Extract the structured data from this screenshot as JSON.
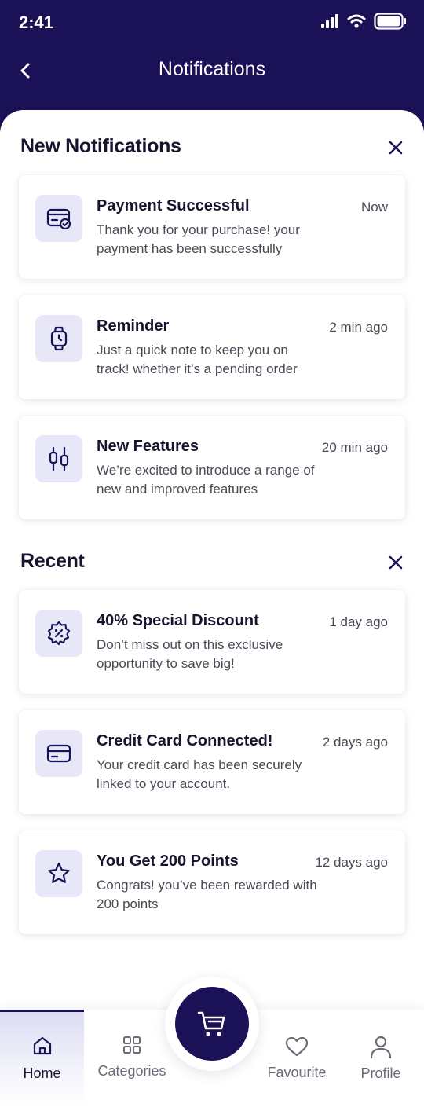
{
  "status_bar": {
    "time": "2:41"
  },
  "header": {
    "title": "Notifications"
  },
  "new_section": {
    "title": "New Notifications",
    "items": [
      {
        "icon": "payment-card-check-icon",
        "title": "Payment Successful",
        "time": "Now",
        "message": "Thank you for your purchase! your payment has been successfully"
      },
      {
        "icon": "watch-clock-icon",
        "title": "Reminder",
        "time": "2 min ago",
        "message": "Just a quick note to keep you on track! whether it’s a pending order"
      },
      {
        "icon": "sliders-icon",
        "title": "New Features",
        "time": "20 min ago",
        "message": "We’re excited to introduce a range of new and improved features"
      }
    ]
  },
  "recent_section": {
    "title": "Recent",
    "items": [
      {
        "icon": "discount-badge-icon",
        "title": "40% Special Discount",
        "time": "1 day ago",
        "message": "Don’t miss out on this exclusive opportunity to save big!"
      },
      {
        "icon": "credit-card-icon",
        "title": "Credit Card Connected!",
        "time": "2 days ago",
        "message": "Your credit card has been securely linked to your account."
      },
      {
        "icon": "star-icon",
        "title": "You Get 200 Points",
        "time": "12 days ago",
        "message": "Congrats! you’ve been rewarded with 200 points"
      }
    ]
  },
  "bottom_nav": {
    "items": [
      {
        "label": "Home",
        "icon": "home-icon",
        "active": true
      },
      {
        "label": "Categories",
        "icon": "grid-icon",
        "active": false
      },
      {
        "label": "Favourite",
        "icon": "heart-icon",
        "active": false
      },
      {
        "label": "Profile",
        "icon": "user-icon",
        "active": false
      }
    ],
    "center_action_icon": "cart-icon"
  },
  "colors": {
    "primary": "#1a1157",
    "icon_bg": "#e8e7f8",
    "text_dark": "#17152e",
    "text_muted": "#4a4a56"
  }
}
